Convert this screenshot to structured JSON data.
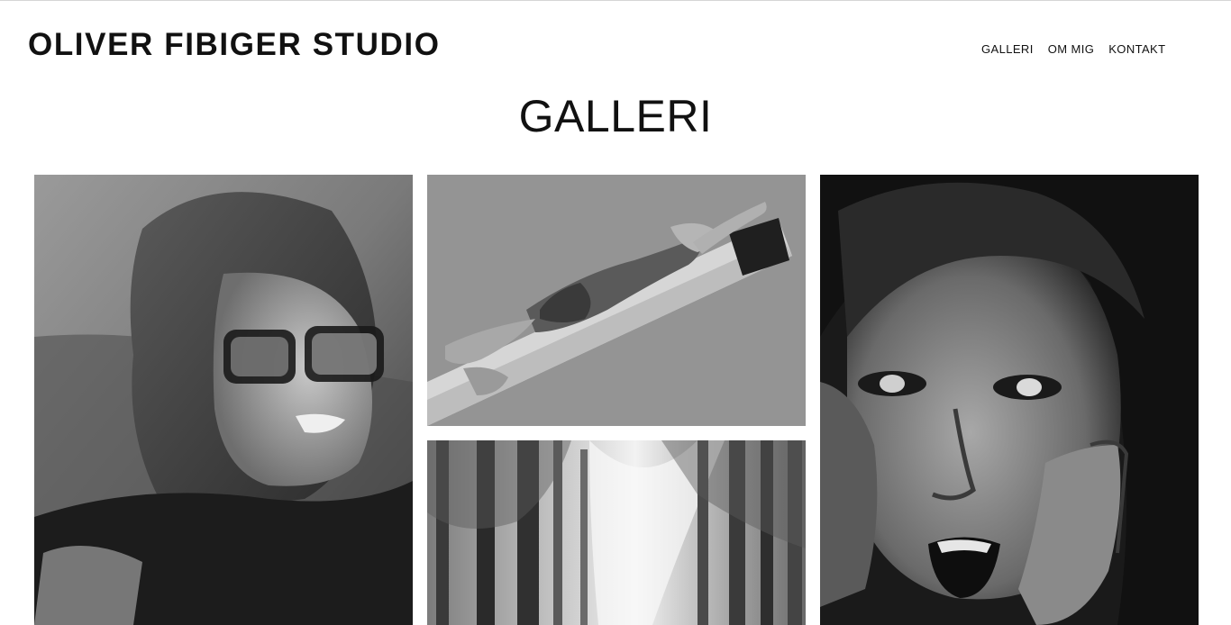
{
  "site": {
    "brand": "OLIVER FIBIGER STUDIO"
  },
  "nav": {
    "items": [
      {
        "label": "GALLERI"
      },
      {
        "label": "OM MIG"
      },
      {
        "label": "KONTAKT"
      }
    ]
  },
  "page": {
    "title": "GALLERI"
  },
  "gallery": {
    "photos": [
      {
        "subject": "portrait with glasses"
      },
      {
        "subject": "woman lying on pole"
      },
      {
        "subject": "forest trees"
      },
      {
        "subject": "face with hand"
      }
    ]
  },
  "colors": {
    "background": "#ffffff",
    "text": "#111111",
    "top_border": "#d6d6d6"
  }
}
